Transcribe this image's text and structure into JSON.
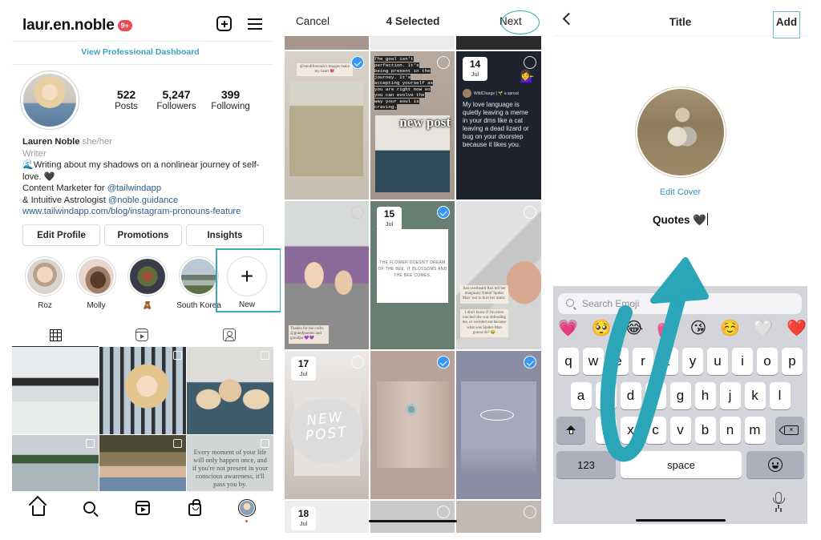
{
  "profile": {
    "username": "laur.en.noble",
    "notification_badge": "9+",
    "pro_dashboard_link": "View Professional Dashboard",
    "stats": [
      {
        "value": "522",
        "label": "Posts"
      },
      {
        "value": "5,247",
        "label": "Followers"
      },
      {
        "value": "399",
        "label": "Following"
      }
    ],
    "bio": {
      "name": "Lauren Noble",
      "pronouns": "she/her",
      "category": "Writer",
      "line1": "🌊Writing about my shadows on a nonlinear journey of self-love. 🖤",
      "line2_prefix": "Content Marketer for ",
      "line2_mention": "@tailwindapp",
      "line3_prefix": "& Intuitive Astrologist ",
      "line3_mention": "@noble.guidance",
      "website": "www.tailwindapp.com/blog/instagram-pronouns-feature"
    },
    "buttons": {
      "edit_profile": "Edit Profile",
      "promotions": "Promotions",
      "insights": "Insights"
    },
    "highlights": [
      {
        "label": "Roz"
      },
      {
        "label": "Molly"
      },
      {
        "label": "🧸"
      },
      {
        "label": "South Korea"
      }
    ],
    "new_highlight_label": "New",
    "new_highlight_symbol": "+",
    "tabs": [
      "grid-icon",
      "reels-icon",
      "tagged-icon"
    ],
    "grid_quote": "Every moment of your life will only happen once, and if you're not present in your conscious awareness, it'll pass you by.",
    "bottom_nav": [
      "home-icon",
      "search-icon",
      "reels-icon",
      "shop-icon",
      "profile-icon"
    ]
  },
  "story_picker": {
    "cancel_label": "Cancel",
    "title": "4 Selected",
    "next_label": "Next",
    "accent_color": "#3897f0",
    "stories": [
      {
        "caption": "@sundiforsouls's images make my heart 💗",
        "selected": true
      },
      {
        "caption": "The goal isn't perfection. It's being present in the journey. It's accepting yourself as you are right now so you can evolve the way your soul is craving.",
        "sticker": "new post",
        "selected": false
      },
      {
        "date_day": "14",
        "date_month": "Jul",
        "tweet_author": "WildCharge | 🌱 a sprout",
        "tweet_text": "My love language is quietly leaving a meme in your dms like a cat leaving a dead lizard or bug on your doorstep because it likes you.",
        "selected": false
      },
      {
        "caption": "Thanks for the crafts @grandparents and grandpa 💜💜",
        "selected": false
      },
      {
        "date_day": "15",
        "date_month": "Jul",
        "quote": "THE FLOWER DOESN'T DREAM OF THE BEE. IT BLOSSOMS AND THE BEE COMES.",
        "selected": true
      },
      {
        "caption1": "Just overheard Roz tell her imaginary friend 'Spider Man' 'not to hurt her mom.'",
        "caption2": "I don't know if I'm more touched she was defending me, or weirded out because what was Spider-Man gonna do? 😂",
        "selected": false
      },
      {
        "date_day": "17",
        "date_month": "Jul",
        "sticker": "NEW POST",
        "selected": false
      },
      {
        "selected": true
      },
      {
        "selected": true
      },
      {
        "date_day": "18",
        "date_month": "Jul",
        "selected": false
      },
      {
        "selected": false
      },
      {
        "selected": false
      }
    ]
  },
  "highlight_title": {
    "title": "Title",
    "add_label": "Add",
    "edit_cover_label": "Edit Cover",
    "highlight_name": "Quotes 🖤",
    "emoji_search_placeholder": "Search Emoji",
    "emojis": [
      "💗",
      "🥺",
      "😂",
      "💕",
      "😘",
      "☺️",
      "🤍",
      "❤️"
    ],
    "keyboard": {
      "row1": [
        "q",
        "w",
        "e",
        "r",
        "t",
        "y",
        "u",
        "i",
        "o",
        "p"
      ],
      "row2": [
        "a",
        "s",
        "d",
        "f",
        "g",
        "h",
        "j",
        "k",
        "l"
      ],
      "row3": [
        "z",
        "x",
        "c",
        "v",
        "b",
        "n",
        "m"
      ],
      "numbers_label": "123",
      "space_label": "space"
    },
    "annotation_color": "#2ba5b8"
  }
}
